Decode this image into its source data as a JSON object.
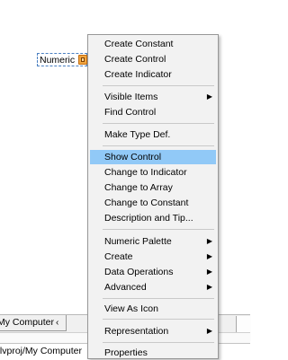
{
  "diagram": {
    "numeric_label": "Numeric"
  },
  "bottom_window": {
    "tab_label": "My Computer",
    "tab_chevron": "‹",
    "path_text": ".lvproj/My Computer"
  },
  "context_menu": {
    "items": {
      "create_constant": "Create Constant",
      "create_control": "Create Control",
      "create_indicator": "Create Indicator",
      "visible_items": "Visible Items",
      "find_control": "Find Control",
      "make_type_def": "Make Type Def.",
      "show_control": "Show Control",
      "change_to_indicator": "Change to Indicator",
      "change_to_array": "Change to Array",
      "change_to_constant": "Change to Constant",
      "description_and_tip": "Description and Tip...",
      "numeric_palette": "Numeric Palette",
      "create": "Create",
      "data_operations": "Data Operations",
      "advanced": "Advanced",
      "view_as_icon": "View As Icon",
      "representation": "Representation",
      "properties": "Properties"
    },
    "highlighted_item": "Show Control",
    "submenu_arrow": "▶"
  },
  "colors": {
    "menu_background": "#f2f2f2",
    "highlight": "#91c9f7",
    "terminal_orange": "#f2a640",
    "selection_dash": "#4a7fc1"
  }
}
